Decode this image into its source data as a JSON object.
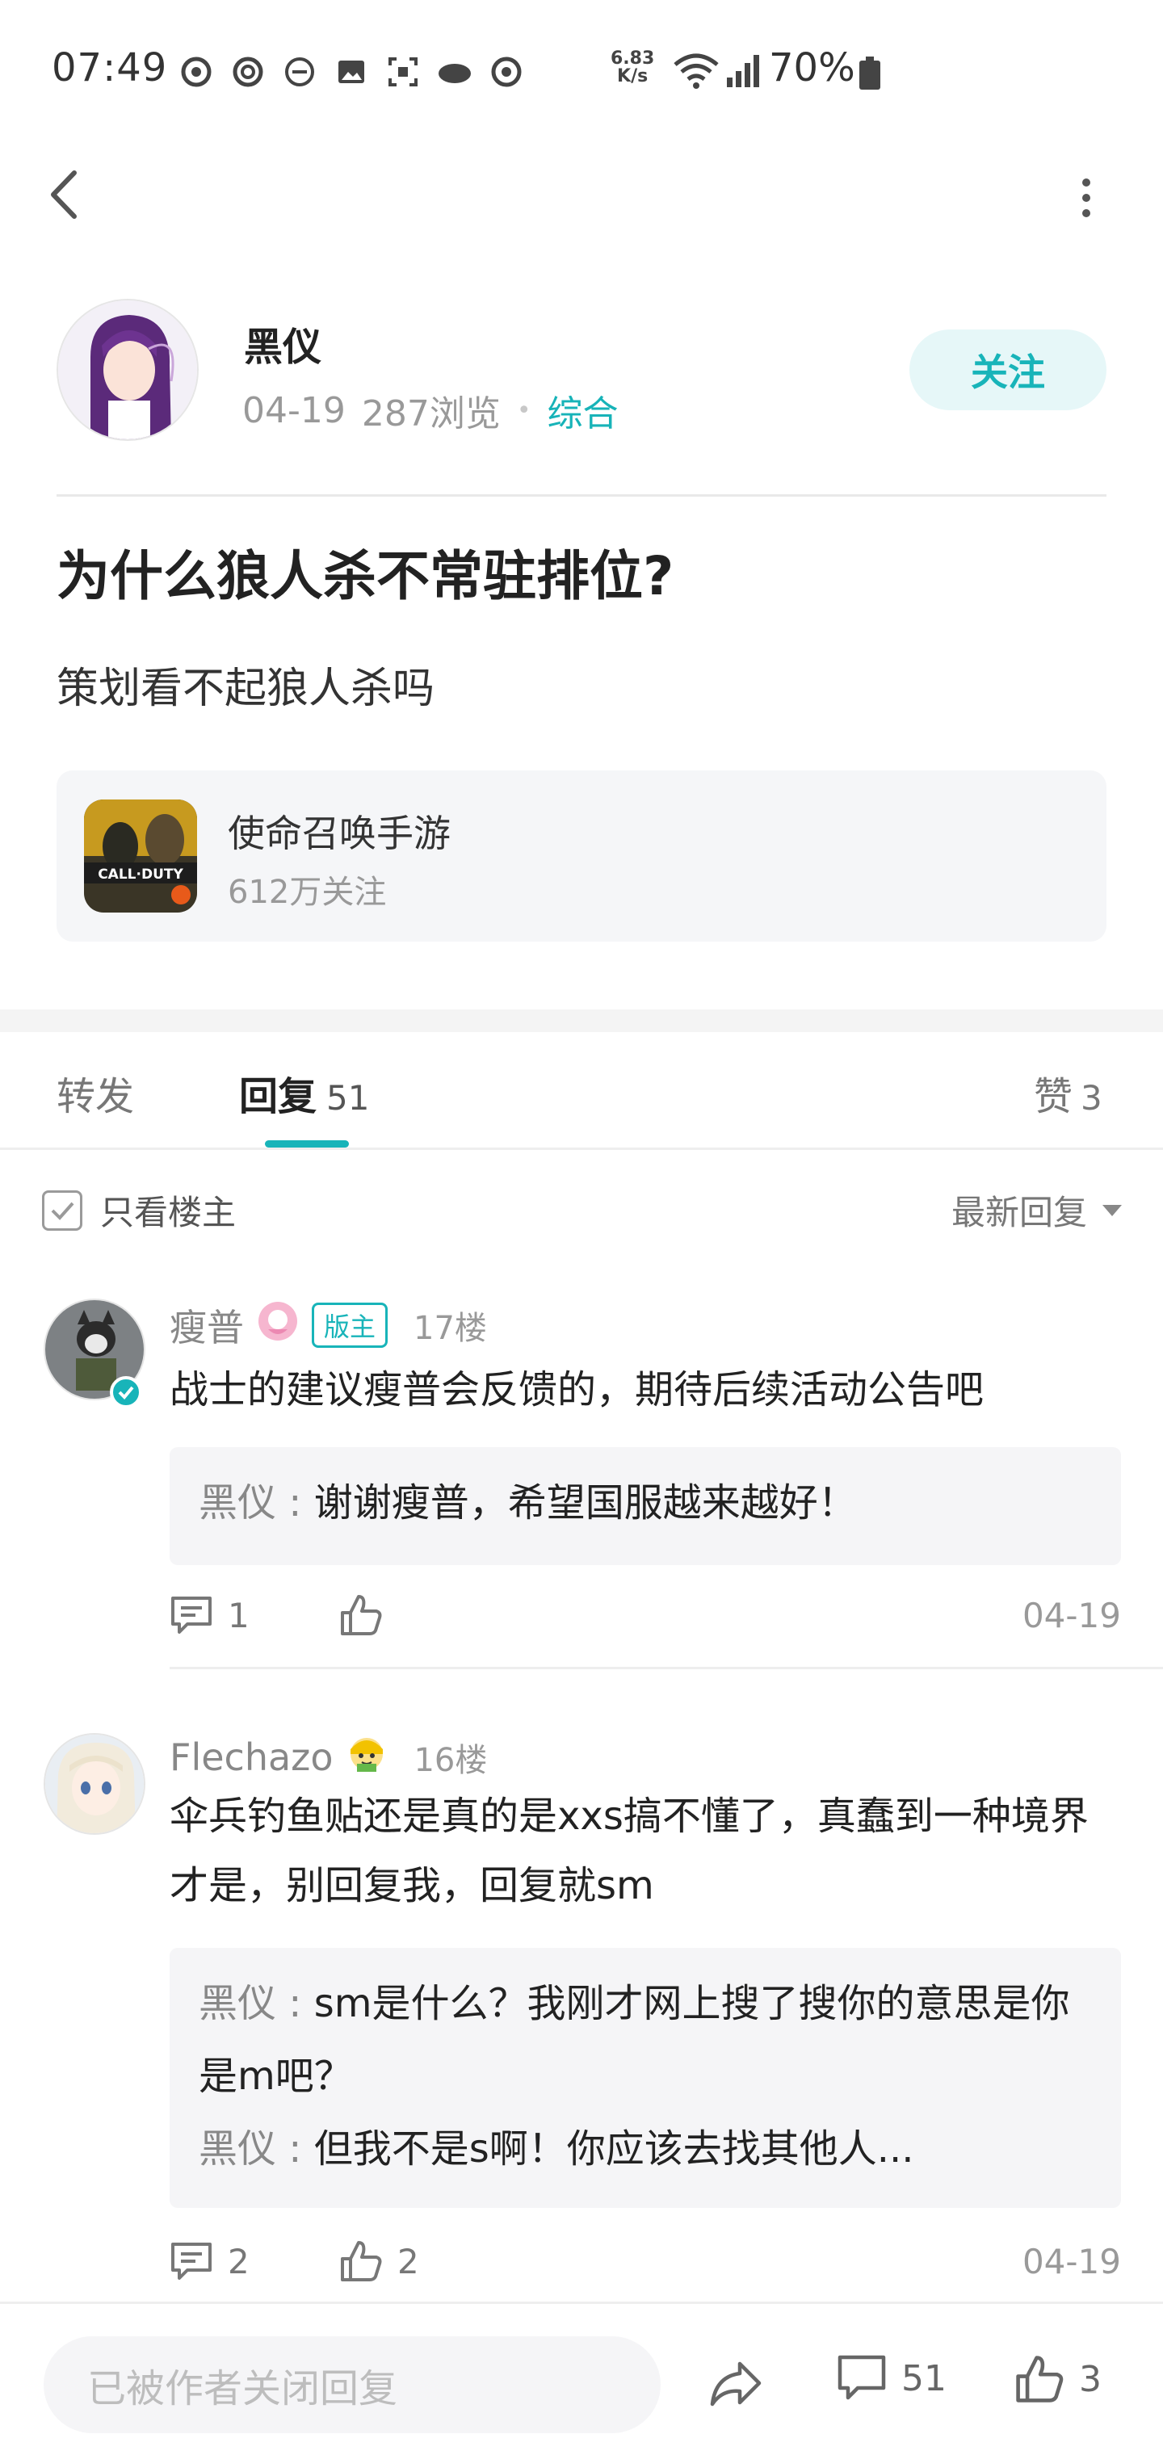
{
  "status_bar": {
    "time": "07:49",
    "net_speed_value": "6.83",
    "net_speed_unit": "K/s",
    "battery": "70%"
  },
  "author": {
    "name": "黑仪",
    "date": "04-19",
    "views": "287浏览",
    "separator": "•",
    "category": "综合",
    "follow_label": "关注"
  },
  "post": {
    "title": "为什么狼人杀不常驻排位?",
    "body": "策划看不起狼人杀吗"
  },
  "game_card": {
    "name": "使命召唤手游",
    "followers": "612万关注",
    "icon_text": "CALL·DUTY"
  },
  "tabs": {
    "repost": "转发",
    "reply": "回复",
    "reply_count": "51",
    "like": "赞",
    "like_count": "3"
  },
  "filter": {
    "only_owner": "只看楼主",
    "sort": "最新回复"
  },
  "comments": [
    {
      "name": "瘦普",
      "badge": "版主",
      "floor": "17楼",
      "text": "战士的建议瘦普会反馈的，期待后续活动公告吧",
      "quotes": [
        {
          "name": "黑仪",
          "sep": " : ",
          "text": "谢谢瘦普，希望国服越来越好！"
        }
      ],
      "reply_count": "1",
      "like_count": "",
      "date": "04-19"
    },
    {
      "name": "Flechazo",
      "floor": "16楼",
      "text": "伞兵钓鱼贴还是真的是xxs搞不懂了，真蠢到一种境界才是，别回复我，回复就sm",
      "quotes": [
        {
          "name": "黑仪",
          "sep": " : ",
          "text": "sm是什么？我刚才网上搜了搜你的意思是你是m吧？"
        },
        {
          "name": "黑仪",
          "sep": " : ",
          "text": "但我不是s啊！你应该去找其他人..."
        }
      ],
      "reply_count": "2",
      "like_count": "2",
      "date": "04-19"
    }
  ],
  "bottom_bar": {
    "input_placeholder": "已被作者关闭回复",
    "comment_count": "51",
    "like_count": "3"
  },
  "colors": {
    "accent": "#18b4b9",
    "follow_bg": "#e6f7f8"
  }
}
